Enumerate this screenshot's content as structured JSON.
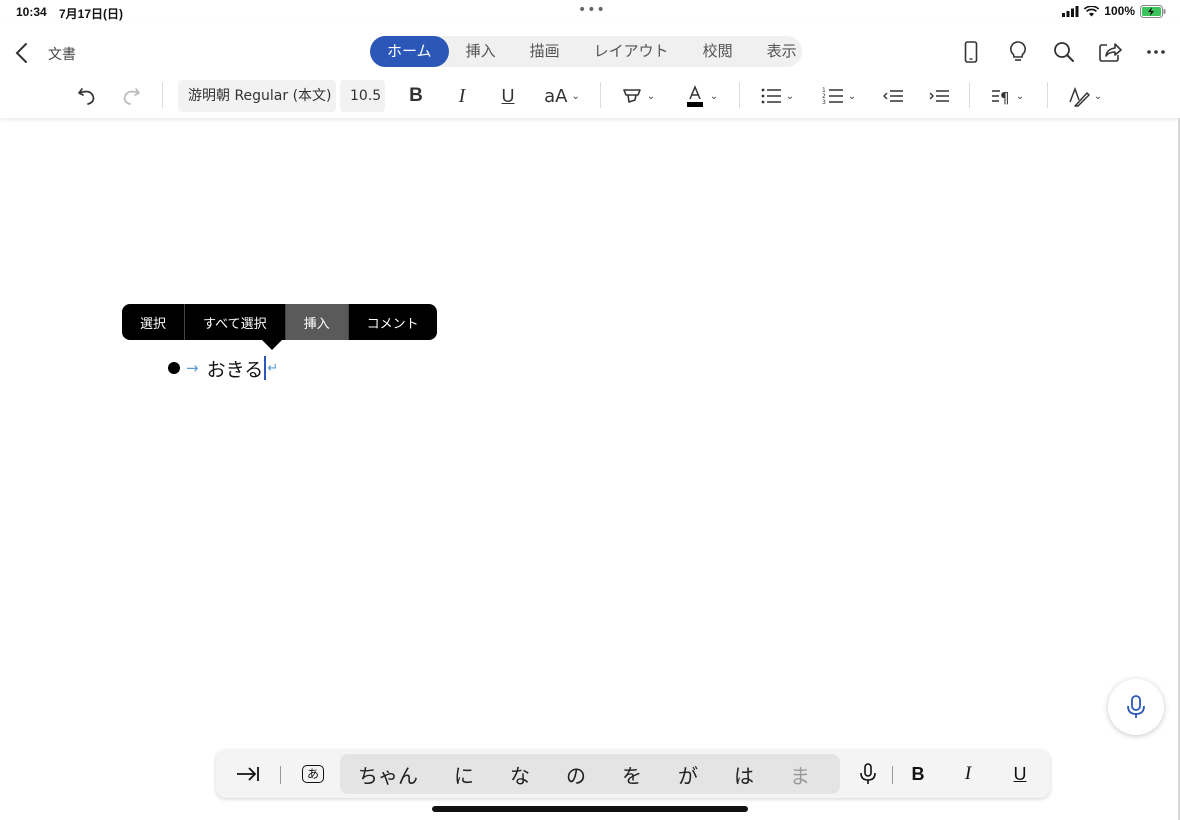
{
  "status": {
    "time": "10:34",
    "date": "7月17日(日)",
    "battery": "100%"
  },
  "header": {
    "doc_title": "文書",
    "tabs": [
      {
        "label": "ホーム",
        "active": true
      },
      {
        "label": "挿入"
      },
      {
        "label": "描画"
      },
      {
        "label": "レイアウト"
      },
      {
        "label": "校閲"
      },
      {
        "label": "表示"
      }
    ],
    "icons": [
      "phone-view-icon",
      "lightbulb-icon",
      "search-icon",
      "share-icon",
      "more-icon"
    ]
  },
  "toolbar": {
    "font_name": "游明朝 Regular (本文)",
    "font_size": "10.5",
    "bold": "B",
    "italic": "I",
    "underline": "U",
    "font_size_style": "aA"
  },
  "document": {
    "bullet_text": "おきる"
  },
  "context_menu": {
    "items": [
      "選択",
      "すべて選択",
      "挿入",
      "コメント"
    ],
    "highlighted": "挿入"
  },
  "keyboard_bar": {
    "kana_key": "あ",
    "candidates": [
      "ちゃん",
      "に",
      "な",
      "の",
      "を",
      "が",
      "は",
      "ま"
    ],
    "bold": "B",
    "italic": "I",
    "underline": "U"
  },
  "colors": {
    "accent": "#2b57b9",
    "font_color_bar": "#000000"
  }
}
